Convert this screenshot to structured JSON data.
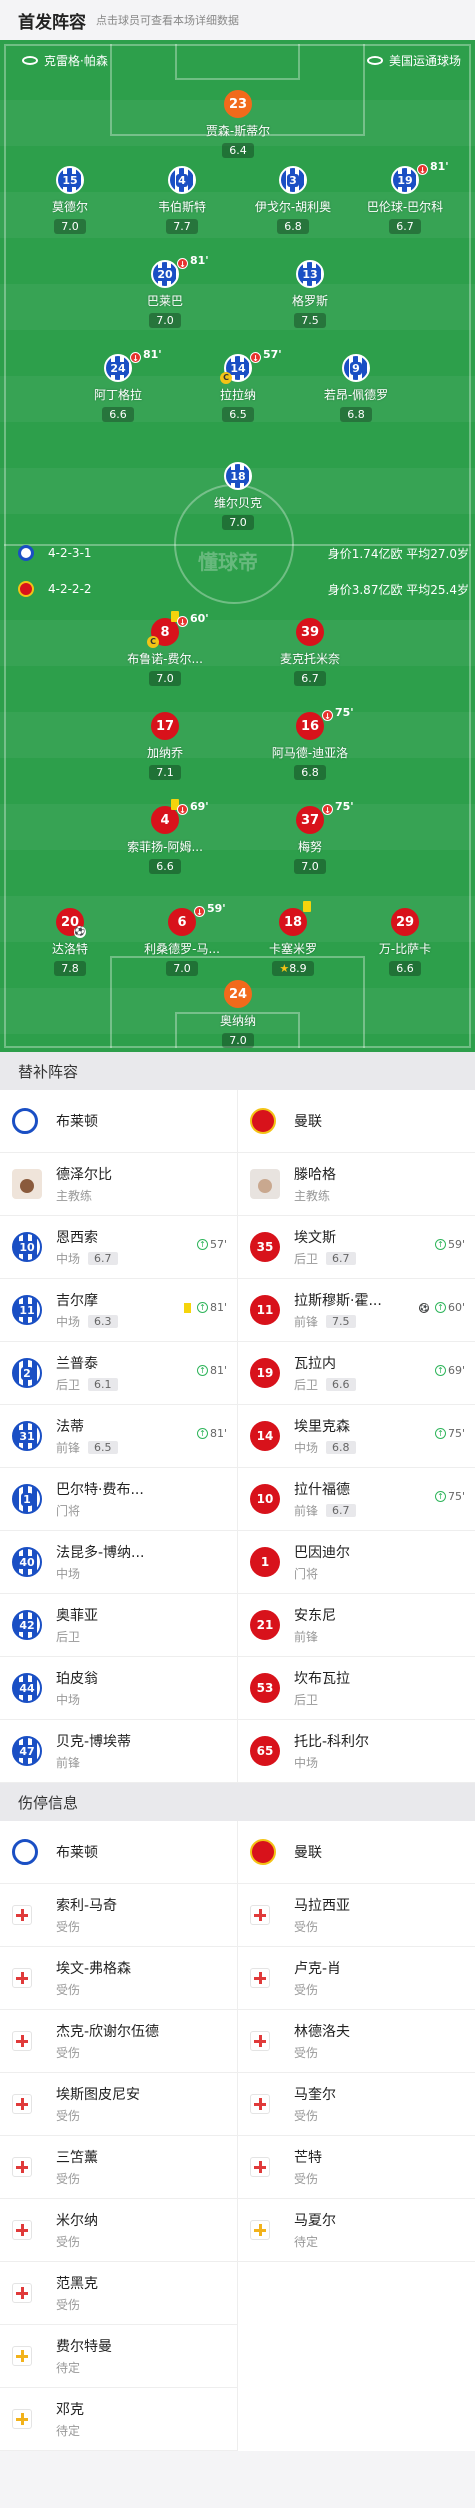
{
  "header": {
    "title": "首发阵容",
    "subtitle": "点击球员可查看本场详细数据"
  },
  "pitch": {
    "home_stadium": "克雷格·帕森",
    "away_stadium": "美国运通球场",
    "watermark": "懂球帝"
  },
  "home_formation": {
    "shape": "4-2-3-1",
    "value": "身价1.74亿欧  平均27.0岁"
  },
  "away_formation": {
    "shape": "4-2-2-2",
    "value": "身价3.87亿欧  平均25.4岁"
  },
  "home_players": [
    {
      "num": "23",
      "name": "贾森-斯蒂尔",
      "rating": "6.4",
      "gk": true
    },
    {
      "num": "15",
      "name": "莫德尔",
      "rating": "7.0"
    },
    {
      "num": "4",
      "name": "韦伯斯特",
      "rating": "7.7"
    },
    {
      "num": "3",
      "name": "伊戈尔-胡利奥",
      "rating": "6.8"
    },
    {
      "num": "19",
      "name": "巴伦球-巴尔科",
      "rating": "6.7",
      "sub_time": "81'"
    },
    {
      "num": "20",
      "name": "巴莱巴",
      "rating": "7.0",
      "sub_time": "81'"
    },
    {
      "num": "13",
      "name": "格罗斯",
      "rating": "7.5"
    },
    {
      "num": "24",
      "name": "阿丁格拉",
      "rating": "6.6",
      "sub_time": "81'"
    },
    {
      "num": "14",
      "name": "拉拉纳",
      "rating": "6.5",
      "sub_time": "57'",
      "captain": "C"
    },
    {
      "num": "9",
      "name": "若昂-佩德罗",
      "rating": "6.8"
    },
    {
      "num": "18",
      "name": "维尔贝克",
      "rating": "7.0"
    }
  ],
  "away_players": [
    {
      "num": "8",
      "name": "布鲁诺-费尔...",
      "rating": "7.0",
      "sub_time": "60'",
      "captain": "C",
      "card": "yellow"
    },
    {
      "num": "39",
      "name": "麦克托米奈",
      "rating": "6.7"
    },
    {
      "num": "17",
      "name": "加纳乔",
      "rating": "7.1"
    },
    {
      "num": "16",
      "name": "阿马德-迪亚洛",
      "rating": "6.8",
      "sub_time": "75'"
    },
    {
      "num": "4",
      "name": "索菲扬-阿姆...",
      "rating": "6.6",
      "sub_time": "69'",
      "card": "yellow"
    },
    {
      "num": "37",
      "name": "梅努",
      "rating": "7.0",
      "sub_time": "75'"
    },
    {
      "num": "20",
      "name": "达洛特",
      "rating": "7.8",
      "goal": true
    },
    {
      "num": "6",
      "name": "利桑德罗-马...",
      "rating": "7.0",
      "sub_time": "59'"
    },
    {
      "num": "18",
      "name": "卡塞米罗",
      "rating": "8.9",
      "star": "★",
      "card": "yellow"
    },
    {
      "num": "29",
      "name": "万-比萨卡",
      "rating": "6.6"
    },
    {
      "num": "24",
      "name": "奥纳纳",
      "rating": "7.0",
      "gk": true
    }
  ],
  "bench": {
    "title": "替补阵容",
    "home_team": "布莱顿",
    "away_team": "曼联",
    "home_coach": {
      "name": "德泽尔比",
      "role": "主教练"
    },
    "away_coach": {
      "name": "滕哈格",
      "role": "主教练"
    },
    "home": [
      {
        "num": "10",
        "name": "恩西索",
        "pos": "中场",
        "rating": "6.7",
        "time": "57'"
      },
      {
        "num": "11",
        "name": "吉尔摩",
        "pos": "中场",
        "rating": "6.3",
        "time": "81'",
        "card": true
      },
      {
        "num": "2",
        "name": "兰普泰",
        "pos": "后卫",
        "rating": "6.1",
        "time": "81'"
      },
      {
        "num": "31",
        "name": "法蒂",
        "pos": "前锋",
        "rating": "6.5",
        "time": "81'"
      },
      {
        "num": "1",
        "name": "巴尔特·费布...",
        "pos": "门将"
      },
      {
        "num": "40",
        "name": "法昆多-博纳...",
        "pos": "中场"
      },
      {
        "num": "42",
        "name": "奥菲亚",
        "pos": "后卫"
      },
      {
        "num": "44",
        "name": "珀皮翁",
        "pos": "中场"
      },
      {
        "num": "47",
        "name": "贝克-博埃蒂",
        "pos": "前锋"
      }
    ],
    "away": [
      {
        "num": "35",
        "name": "埃文斯",
        "pos": "后卫",
        "rating": "6.7",
        "time": "59'"
      },
      {
        "num": "11",
        "name": "拉斯穆斯·霍...",
        "pos": "前锋",
        "rating": "7.5",
        "time": "60'",
        "goal": true
      },
      {
        "num": "19",
        "name": "瓦拉内",
        "pos": "后卫",
        "rating": "6.6",
        "time": "69'"
      },
      {
        "num": "14",
        "name": "埃里克森",
        "pos": "中场",
        "rating": "6.8",
        "time": "75'"
      },
      {
        "num": "10",
        "name": "拉什福德",
        "pos": "前锋",
        "rating": "6.7",
        "time": "75'"
      },
      {
        "num": "1",
        "name": "巴因迪尔",
        "pos": "门将"
      },
      {
        "num": "21",
        "name": "安东尼",
        "pos": "前锋"
      },
      {
        "num": "53",
        "name": "坎布瓦拉",
        "pos": "后卫"
      },
      {
        "num": "65",
        "name": "托比-科利尔",
        "pos": "中场"
      }
    ]
  },
  "injuries": {
    "title": "伤停信息",
    "home_team": "布莱顿",
    "away_team": "曼联",
    "home": [
      {
        "name": "索利-马奇",
        "status": "受伤"
      },
      {
        "name": "埃文-弗格森",
        "status": "受伤"
      },
      {
        "name": "杰克-欣谢尔伍德",
        "status": "受伤"
      },
      {
        "name": "埃斯图皮尼安",
        "status": "受伤"
      },
      {
        "name": "三笘薰",
        "status": "受伤"
      },
      {
        "name": "米尔纳",
        "status": "受伤"
      },
      {
        "name": "范黑克",
        "status": "受伤"
      },
      {
        "name": "费尔特曼",
        "status": "待定",
        "q": true
      },
      {
        "name": "邓克",
        "status": "待定",
        "q": true
      }
    ],
    "away": [
      {
        "name": "马拉西亚",
        "status": "受伤"
      },
      {
        "name": "卢克-肖",
        "status": "受伤"
      },
      {
        "name": "林德洛夫",
        "status": "受伤"
      },
      {
        "name": "马奎尔",
        "status": "受伤"
      },
      {
        "name": "芒特",
        "status": "受伤"
      },
      {
        "name": "马夏尔",
        "status": "待定",
        "q": true
      }
    ]
  },
  "colors": {
    "pitch": "#2d9f4b",
    "brighton_blue": "#1a4fc4",
    "manutd_red": "#d8121b",
    "keeper_orange": "#f26a1b"
  }
}
